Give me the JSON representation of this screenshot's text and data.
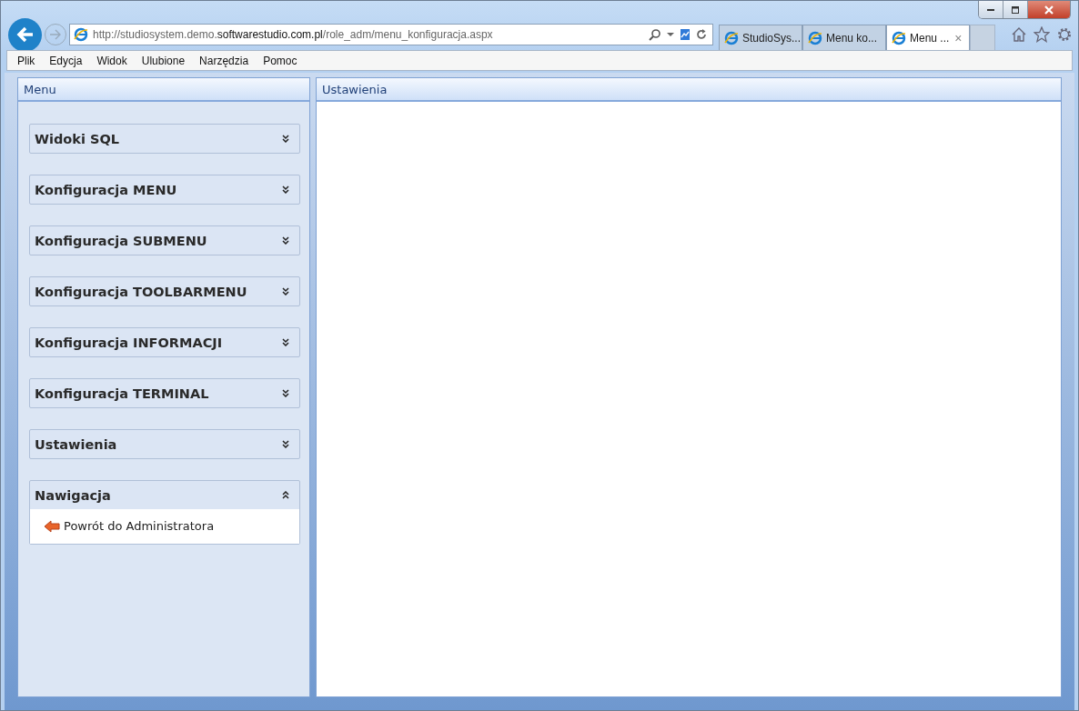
{
  "browser": {
    "url": "http://studiosystem.demo.**softwarestudio.com.pl**/role_adm/menu_konfiguracja.aspx",
    "tabs": [
      {
        "label": "StudioSys...",
        "selected": false
      },
      {
        "label": "Menu ko...",
        "selected": false
      },
      {
        "label": "Menu ...",
        "selected": true,
        "close": "×"
      }
    ]
  },
  "menubar": [
    "Plik",
    "Edycja",
    "Widok",
    "Ulubione",
    "Narzędzia",
    "Pomoc"
  ],
  "left_panel": {
    "title": "Menu",
    "sections": [
      {
        "title": "Widoki SQL",
        "expanded": false
      },
      {
        "title": "Konfiguracja MENU",
        "expanded": false
      },
      {
        "title": "Konfiguracja SUBMENU",
        "expanded": false
      },
      {
        "title": "Konfiguracja TOOLBARMENU",
        "expanded": false
      },
      {
        "title": "Konfiguracja INFORMACJI",
        "expanded": false
      },
      {
        "title": "Konfiguracja TERMINAL",
        "expanded": false
      },
      {
        "title": "Ustawienia",
        "expanded": false
      },
      {
        "title": "Nawigacja",
        "expanded": true,
        "items": [
          "Powrót do Administratora"
        ]
      }
    ]
  },
  "right_panel": {
    "title": "Ustawienia"
  }
}
